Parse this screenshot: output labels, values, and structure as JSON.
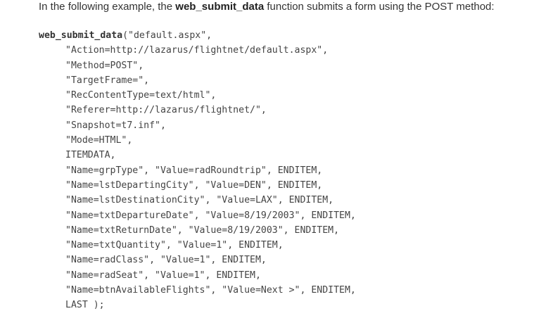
{
  "intro": {
    "prefix": "In the following example, the ",
    "function_name": "web_submit_data",
    "suffix": " function submits a form using the POST method:"
  },
  "code": {
    "first_line_fn": "web_submit_data",
    "first_line_rest": "(\"default.aspx\",",
    "lines": [
      "\"Action=http://lazarus/flightnet/default.aspx\",",
      "\"Method=POST\",",
      "\"TargetFrame=\",",
      "\"RecContentType=text/html\",",
      "\"Referer=http://lazarus/flightnet/\",",
      "\"Snapshot=t7.inf\",",
      "\"Mode=HTML\",",
      "ITEMDATA,",
      "\"Name=grpType\", \"Value=radRoundtrip\", ENDITEM,",
      "\"Name=lstDepartingCity\", \"Value=DEN\", ENDITEM,",
      "\"Name=lstDestinationCity\", \"Value=LAX\", ENDITEM,",
      "\"Name=txtDepartureDate\", \"Value=8/19/2003\", ENDITEM,",
      "\"Name=txtReturnDate\", \"Value=8/19/2003\", ENDITEM,",
      "\"Name=txtQuantity\", \"Value=1\", ENDITEM,",
      "\"Name=radClass\", \"Value=1\", ENDITEM,",
      "\"Name=radSeat\", \"Value=1\", ENDITEM,",
      "\"Name=btnAvailableFlights\", \"Value=Next >\", ENDITEM,",
      "LAST );"
    ]
  }
}
